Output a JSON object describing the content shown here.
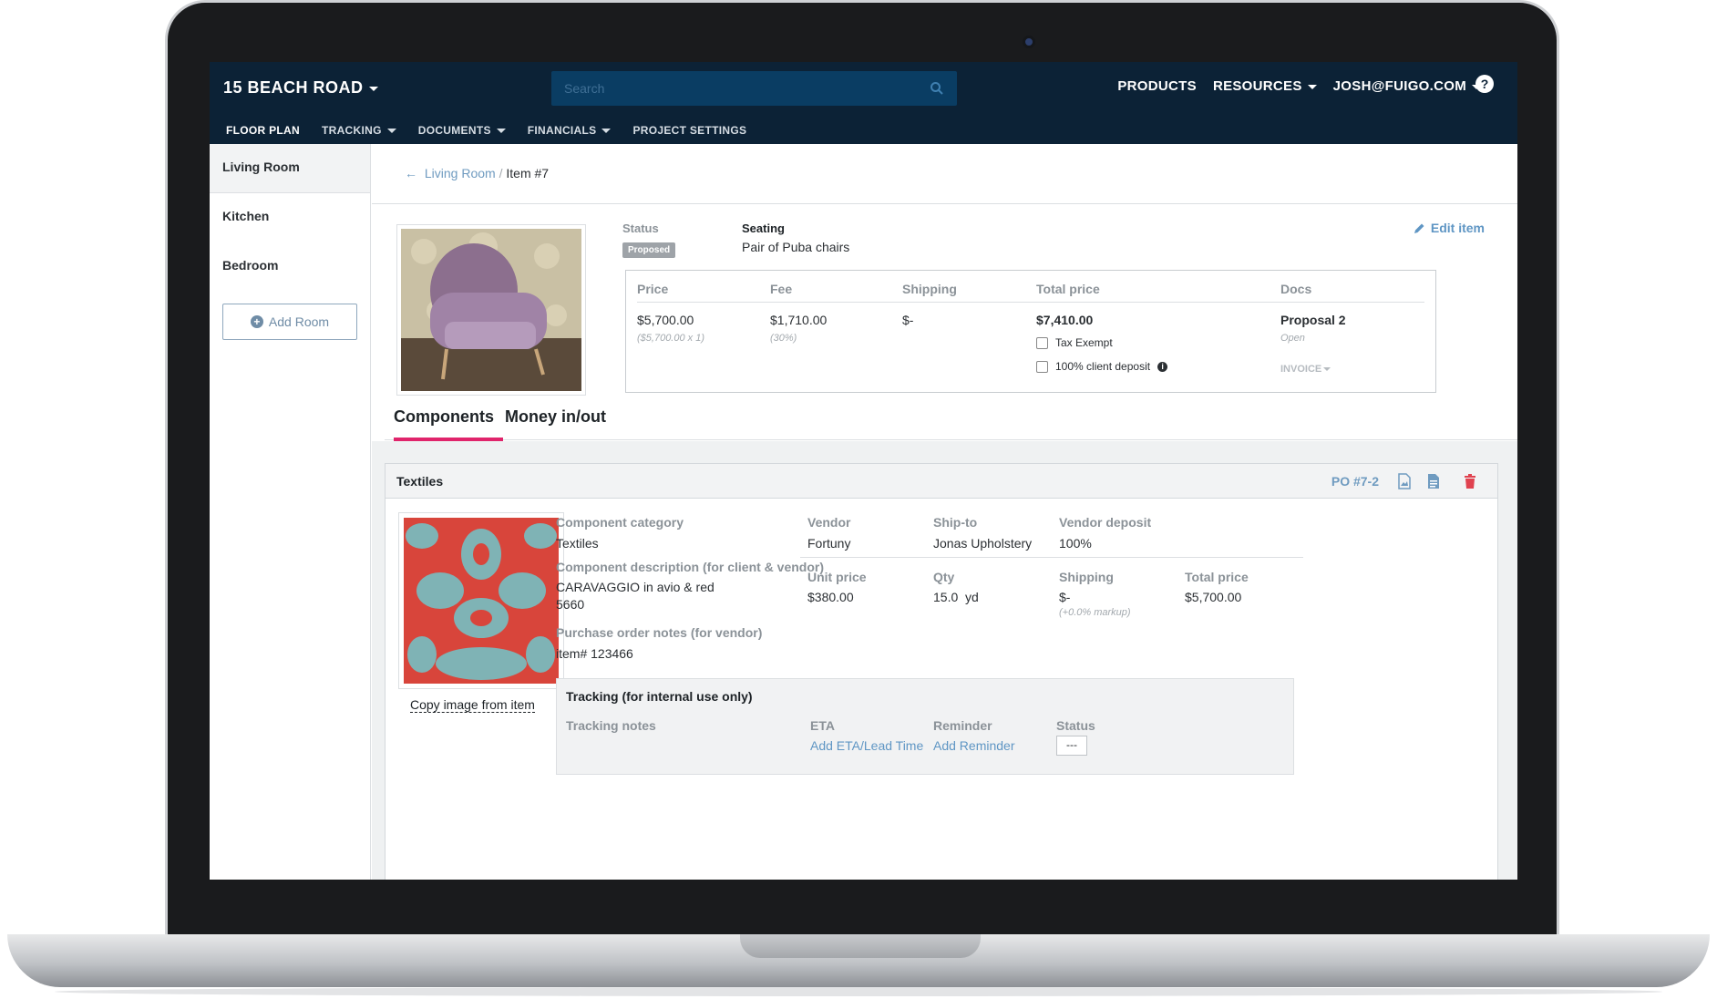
{
  "colors": {
    "topbar": "#0c2236",
    "accent": "#e0246b",
    "link": "#5f96c4"
  },
  "header": {
    "project": "15 BEACH ROAD",
    "search_placeholder": "Search",
    "nav": [
      "PRODUCTS",
      "RESOURCES",
      "JOSH@FUIGO.COM"
    ],
    "help": "?"
  },
  "subnav": [
    "FLOOR PLAN",
    "TRACKING",
    "DOCUMENTS",
    "FINANCIALS",
    "PROJECT SETTINGS"
  ],
  "sidebar": {
    "rooms": [
      "Living Room",
      "Kitchen",
      "Bedroom"
    ],
    "add_room": "Add Room"
  },
  "breadcrumb": {
    "parent": "Living Room",
    "separator": "/",
    "current": "Item #7"
  },
  "item": {
    "status_label": "Status",
    "status": "Proposed",
    "type": "Seating",
    "name": "Pair of Puba chairs",
    "edit": "Edit item"
  },
  "pricing": {
    "headers": [
      "Price",
      "Fee",
      "Shipping",
      "Total price",
      "Docs"
    ],
    "price": "$5,700.00",
    "price_sub": "($5,700.00 x 1)",
    "fee": "$1,710.00",
    "fee_sub": "(30%)",
    "shipping": "$-",
    "total": "$7,410.00",
    "tax_exempt": "Tax Exempt",
    "deposit": "100% client deposit",
    "doc": "Proposal 2",
    "doc_status": "Open",
    "invoice": "INVOICE"
  },
  "tabs": [
    "Components",
    "Money in/out"
  ],
  "component": {
    "title": "Textiles",
    "po": "PO #7-2",
    "copy_image": "Copy image from item",
    "category_label": "Component category",
    "category": "Textiles",
    "description_label": "Component description (for client & vendor)",
    "description_line1": "CARAVAGGIO in avio & red",
    "description_line2": "5660",
    "po_notes_label": "Purchase order notes (for vendor)",
    "po_notes": "item# 123466",
    "vendor_label": "Vendor",
    "vendor": "Fortuny",
    "shipto_label": "Ship-to",
    "shipto": "Jonas Upholstery",
    "deposit_label": "Vendor deposit",
    "deposit": "100%",
    "unit_label": "Unit price",
    "unit": "$380.00",
    "qty_label": "Qty",
    "qty": "15.0  yd",
    "shipping_label": "Shipping",
    "shipping": "$-",
    "shipping_sub": "(+0.0% markup)",
    "total_label": "Total price",
    "total": "$5,700.00"
  },
  "tracking": {
    "title": "Tracking (for internal use only)",
    "notes_label": "Tracking notes",
    "eta_label": "ETA",
    "eta_link": "Add ETA/Lead Time",
    "reminder_label": "Reminder",
    "reminder_link": "Add Reminder",
    "status_label": "Status",
    "status_value": "---"
  }
}
